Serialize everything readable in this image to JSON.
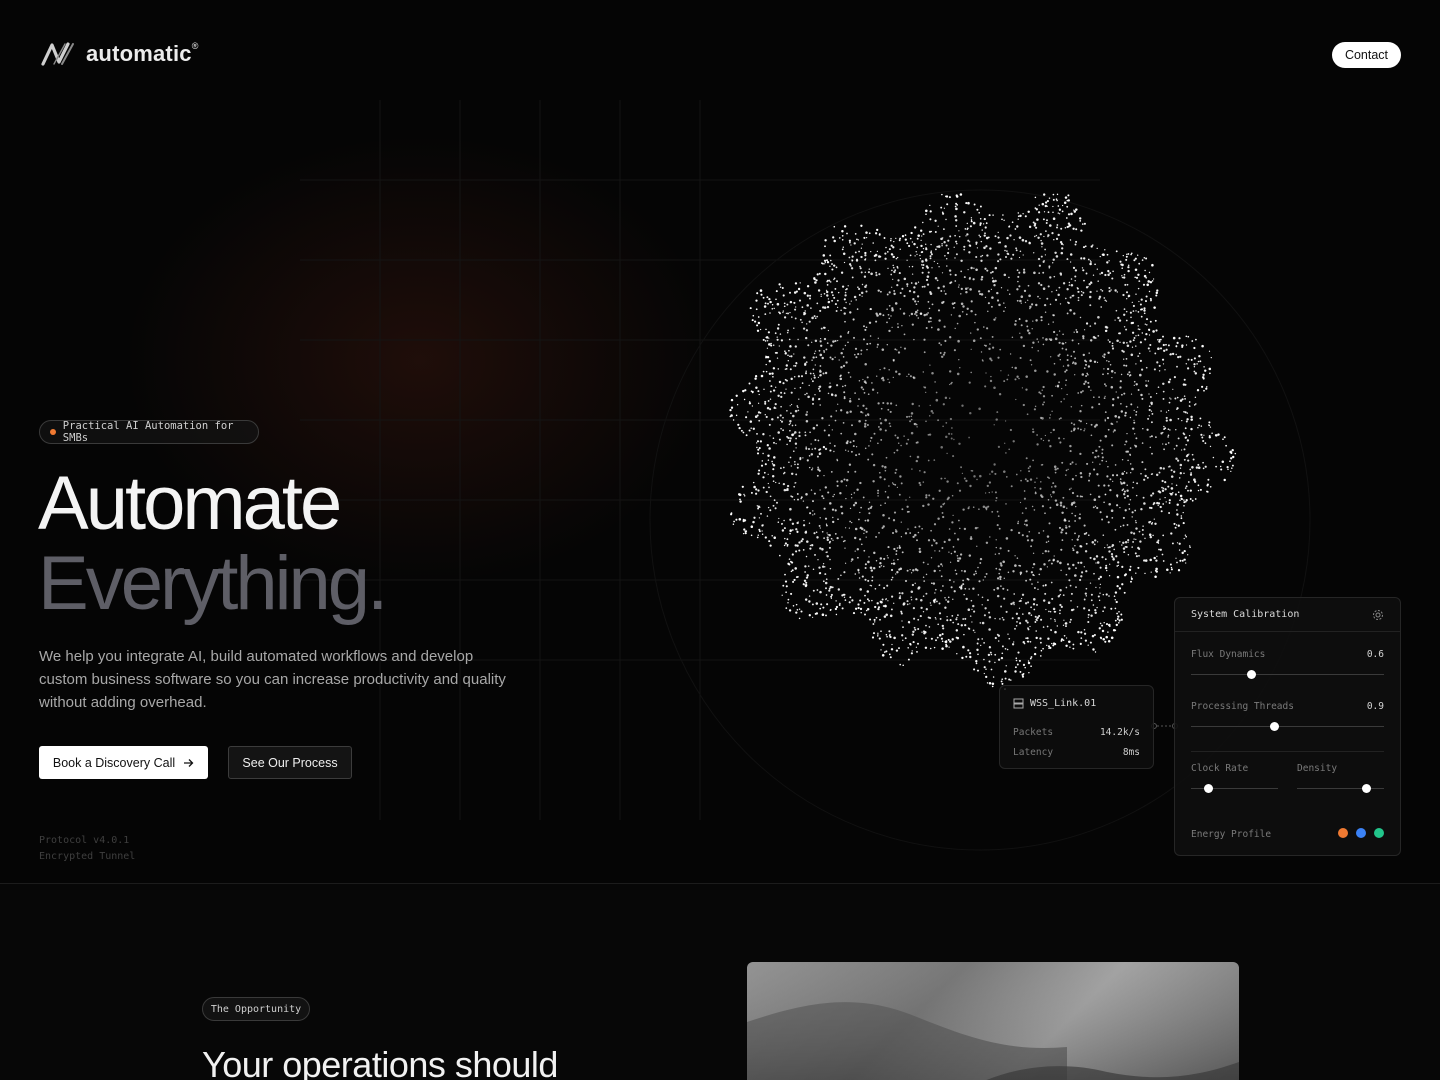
{
  "brand": {
    "name": "automatic",
    "mark": "®"
  },
  "nav": {
    "contact_label": "Contact"
  },
  "hero": {
    "badge": "Practical AI Automation for SMBs",
    "title_line1": "Automate",
    "title_line2": "Everything.",
    "lead": "We help you integrate AI, build automated workflows and develop custom business software so you can increase productivity and quality without adding overhead.",
    "primary_cta": "Book a Discovery Call",
    "secondary_cta": "See Our Process",
    "protocol_line1": "Protocol v4.0.1",
    "protocol_line2": "Encrypted Tunnel"
  },
  "wss_panel": {
    "title": "WSS_Link.01",
    "rows": [
      {
        "label": "Packets",
        "value": "14.2k/s"
      },
      {
        "label": "Latency",
        "value": "8ms"
      }
    ]
  },
  "calibration": {
    "title": "System Calibration",
    "flux": {
      "label": "Flux Dynamics",
      "value": "0.6",
      "level": 0.31
    },
    "threads": {
      "label": "Processing Threads",
      "value": "0.9",
      "level": 0.43
    },
    "clock": {
      "label": "Clock Rate",
      "level": 0.2
    },
    "density": {
      "label": "Density",
      "level": 0.79
    },
    "energy_label": "Energy Profile",
    "energy_colors": [
      "#f07a32",
      "#3b82f6",
      "#22c58b"
    ]
  },
  "opportunity": {
    "badge": "The Opportunity",
    "heading": "Your operations should"
  },
  "colors": {
    "accent": "#f07a32",
    "background": "#050505"
  }
}
